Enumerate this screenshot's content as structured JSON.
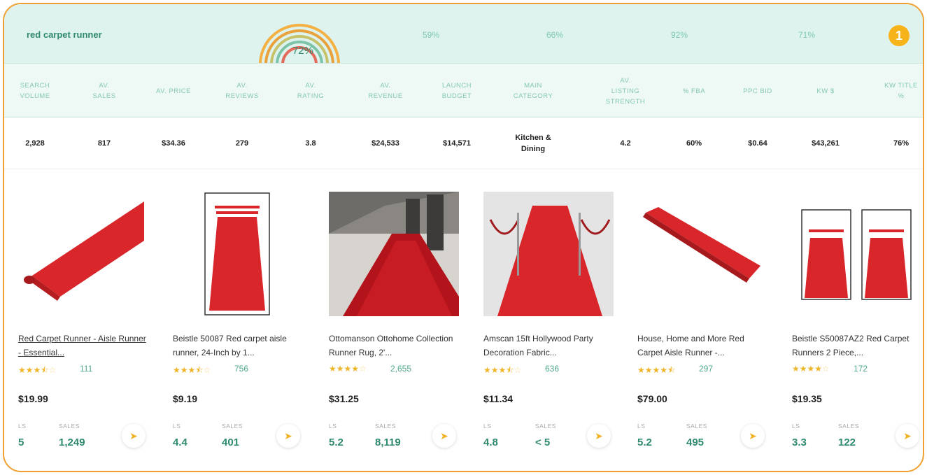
{
  "keyword": "red carpet runner",
  "gauge_value": "72%",
  "gauge_fraction": 0.72,
  "percentages": [
    "59%",
    "66%",
    "92%",
    "71%"
  ],
  "badge": "1",
  "headers": [
    "SEARCH\nVOLUME",
    "AV.\nSALES",
    "AV. PRICE",
    "AV.\nREVIEWS",
    "AV.\nRATING",
    "AV.\nREVENUE",
    "LAUNCH\nBUDGET",
    "MAIN\nCATEGORY",
    "AV.\nLISTING\nSTRENGTH",
    "% FBA",
    "PPC BID",
    "KW $",
    "KW TITLE\n%"
  ],
  "values": [
    "2,928",
    "817",
    "$34.36",
    "279",
    "3.8",
    "$24,533",
    "$14,571",
    "Kitchen &\nDining",
    "4.2",
    "60%",
    "$0.64",
    "$43,261",
    "76%"
  ],
  "products": [
    {
      "title": "Red Carpet Runner - Aisle Runner - Essential...",
      "stars": 3.5,
      "reviews": "111",
      "price": "$19.99",
      "ls_label": "LS",
      "sales_label": "SALES",
      "ls": "5",
      "sales": "1,249"
    },
    {
      "title": "Beistle 50087 Red carpet aisle runner, 24-Inch by 1...",
      "stars": 3.5,
      "reviews": "756",
      "price": "$9.19",
      "ls_label": "LS",
      "sales_label": "SALES",
      "ls": "4.4",
      "sales": "401"
    },
    {
      "title": "Ottomanson Ottohome Collection Runner Rug, 2'...",
      "stars": 4,
      "reviews": "2,655",
      "price": "$31.25",
      "ls_label": "LS",
      "sales_label": "SALES",
      "ls": "5.2",
      "sales": "8,119"
    },
    {
      "title": "Amscan 15ft Hollywood Party Decoration Fabric...",
      "stars": 3.5,
      "reviews": "636",
      "price": "$11.34",
      "ls_label": "LS",
      "sales_label": "SALES",
      "ls": "4.8",
      "sales": "< 5"
    },
    {
      "title": "House, Home and More Red Carpet Aisle Runner -...",
      "stars": 4.5,
      "reviews": "297",
      "price": "$79.00",
      "ls_label": "LS",
      "sales_label": "SALES",
      "ls": "5.2",
      "sales": "495"
    },
    {
      "title": "Beistle S50087AZ2 Red Carpet Runners 2 Piece,...",
      "stars": 4,
      "reviews": "172",
      "price": "$19.35",
      "ls_label": "LS",
      "sales_label": "SALES",
      "ls": "3.3",
      "sales": "122"
    }
  ],
  "colors": {
    "accent": "#2f8a70",
    "band": "#dff3ee",
    "border": "#f0a030",
    "star": "#f0b429",
    "carpet": "#d8262b"
  }
}
